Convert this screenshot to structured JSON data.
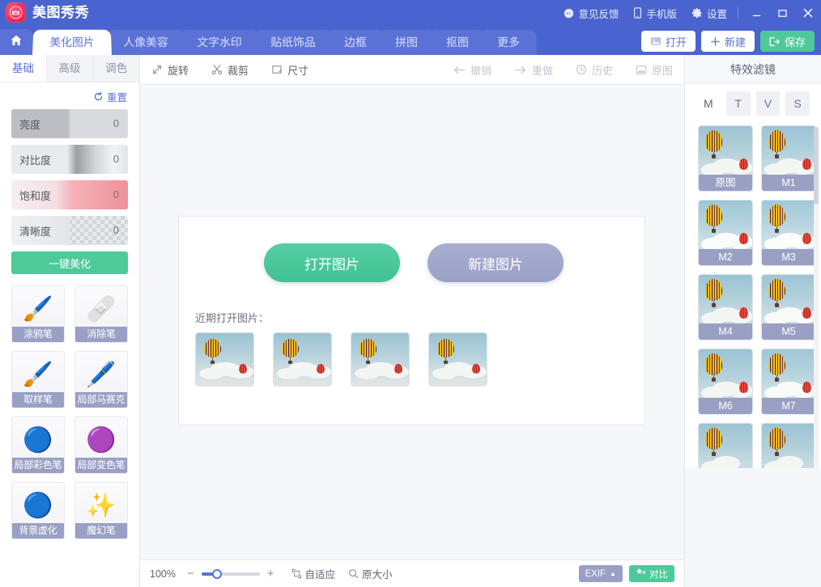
{
  "app": {
    "title": "美图秀秀",
    "logo_icon": "meitu-logo-icon"
  },
  "titlebar": {
    "feedback": "意见反馈",
    "mobile": "手机版",
    "settings": "设置",
    "minimize": "—",
    "maximize": "▢",
    "close": "✕"
  },
  "tabs": [
    {
      "label": "美化图片",
      "active": true
    },
    {
      "label": "人像美容",
      "active": false
    },
    {
      "label": "文字水印",
      "active": false
    },
    {
      "label": "贴纸饰品",
      "active": false
    },
    {
      "label": "边框",
      "active": false
    },
    {
      "label": "拼图",
      "active": false
    },
    {
      "label": "抠图",
      "active": false
    },
    {
      "label": "更多",
      "active": false
    }
  ],
  "header_actions": {
    "open": "打开",
    "new": "新建",
    "save": "保存"
  },
  "sidebar": {
    "tabs": [
      {
        "label": "基础",
        "active": true
      },
      {
        "label": "高级",
        "active": false
      },
      {
        "label": "调色",
        "active": false
      }
    ],
    "reset": "重置",
    "sliders": [
      {
        "label": "亮度",
        "value": "0"
      },
      {
        "label": "对比度",
        "value": "0"
      },
      {
        "label": "饱和度",
        "value": "0"
      },
      {
        "label": "清晰度",
        "value": "0"
      }
    ],
    "beautify": "一键美化",
    "tools": [
      {
        "label": "涂鸦笔",
        "glyph": "🖌"
      },
      {
        "label": "消除笔",
        "glyph": "🩹"
      },
      {
        "label": "取样笔",
        "glyph": "🖌"
      },
      {
        "label": "局部马赛克",
        "glyph": "🖊"
      },
      {
        "label": "局部彩色笔",
        "glyph": "🔵"
      },
      {
        "label": "局部变色笔",
        "glyph": "🟣"
      },
      {
        "label": "背景虚化",
        "glyph": "🔵"
      },
      {
        "label": "魔幻笔",
        "glyph": "✨"
      }
    ]
  },
  "canvas_toolbar": {
    "left": [
      {
        "label": "旋转",
        "icon": "rotate-icon",
        "disabled": false
      },
      {
        "label": "裁剪",
        "icon": "scissors-icon",
        "disabled": false
      },
      {
        "label": "尺寸",
        "icon": "resize-icon",
        "disabled": false
      }
    ],
    "right": [
      {
        "label": "撤销",
        "icon": "undo-arrow-icon",
        "disabled": true
      },
      {
        "label": "重做",
        "icon": "redo-arrow-icon",
        "disabled": true
      },
      {
        "label": "历史",
        "icon": "clock-icon",
        "disabled": true
      },
      {
        "label": "原图",
        "icon": "image-icon",
        "disabled": true
      }
    ]
  },
  "start_card": {
    "open_image": "打开图片",
    "new_image": "新建图片",
    "recent_label": "近期打开图片：",
    "recent_count": 4
  },
  "statusbar": {
    "zoom": "100%",
    "minus": "−",
    "plus": "+",
    "fit": "自适应",
    "actual": "原大小",
    "exif": "EXIF",
    "exif_caret": "▲",
    "compare": "对比"
  },
  "rightpanel": {
    "title": "特效滤镜",
    "tabs": [
      {
        "label": "M",
        "active": true
      },
      {
        "label": "T",
        "active": false
      },
      {
        "label": "V",
        "active": false
      },
      {
        "label": "S",
        "active": false
      }
    ],
    "filters": [
      {
        "label": "原图"
      },
      {
        "label": "M1"
      },
      {
        "label": "M2"
      },
      {
        "label": "M3"
      },
      {
        "label": "M4"
      },
      {
        "label": "M5"
      },
      {
        "label": "M6"
      },
      {
        "label": "M7"
      },
      {
        "label": ""
      },
      {
        "label": ""
      }
    ]
  },
  "colors": {
    "brand_blue": "#4a64cf",
    "accent_green": "#4ec99a",
    "caption_purple": "#9aa0c4",
    "canvas_bg": "#f5f7fb",
    "logo_pink": "#f2295b"
  }
}
